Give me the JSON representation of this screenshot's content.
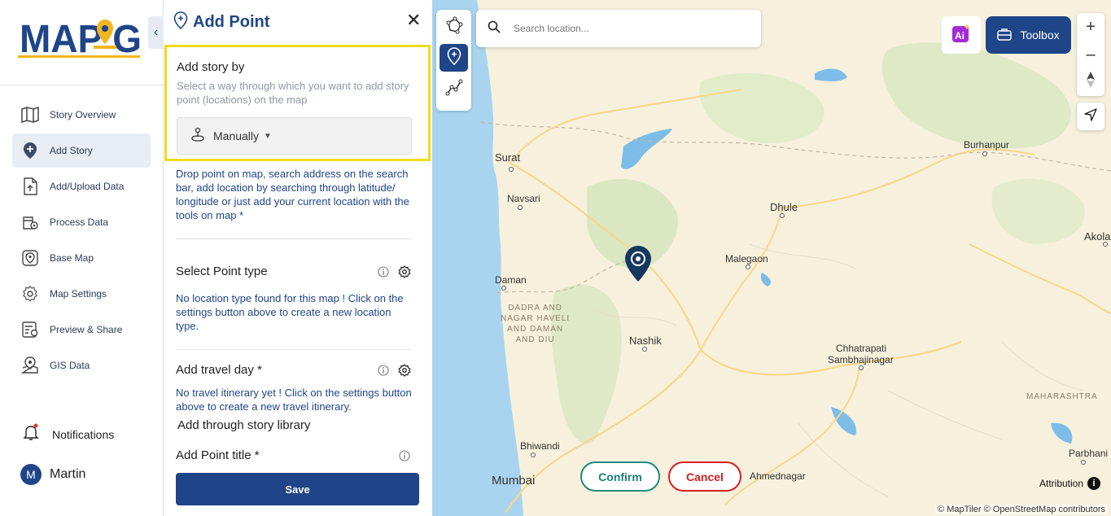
{
  "app": {
    "logo_text": "MAPOG"
  },
  "sidebar": {
    "items": [
      {
        "label": "Story Overview",
        "icon": "map-book-icon"
      },
      {
        "label": "Add Story",
        "icon": "map-pin-plus-icon",
        "active": true
      },
      {
        "label": "Add/Upload Data",
        "icon": "upload-file-icon"
      },
      {
        "label": "Process Data",
        "icon": "process-data-icon"
      },
      {
        "label": "Base Map",
        "icon": "base-map-icon"
      },
      {
        "label": "Map Settings",
        "icon": "gear-icon"
      },
      {
        "label": "Preview & Share",
        "icon": "preview-share-icon"
      },
      {
        "label": "GIS Data",
        "icon": "gis-data-icon"
      }
    ],
    "notifications_label": "Notifications",
    "user": {
      "initial": "M",
      "name": "Martin"
    }
  },
  "panel": {
    "title": "Add Point",
    "story_by": {
      "title": "Add story by",
      "description": "Select a way through which you want to add story point (locations) on the map",
      "selected": "Manually"
    },
    "help_text": "Drop point on map, search address on the search bar, add location by searching through latitude/ longitude or just add your current location with the tools on map *",
    "point_type": {
      "title": "Select Point type",
      "message": "No location type found for this map ! Click on the settings button above to create a new location type."
    },
    "travel_day": {
      "title": "Add travel day *",
      "message": "No travel itinerary yet ! Click on the settings button above to create a new travel itinerary."
    },
    "library_label": "Add through story library",
    "point_title_label": "Add Point title *",
    "save_label": "Save"
  },
  "map": {
    "search_placeholder": "Search location...",
    "toolbox_label": "Toolbox",
    "confirm_label": "Confirm",
    "cancel_label": "Cancel",
    "attribution_label": "Attribution",
    "copyright": "© MapTiler © OpenStreetMap contributors",
    "cities": {
      "surat": "Surat",
      "navsari": "Navsari",
      "dhule": "Dhule",
      "burhanpur": "Burhanpur",
      "akola": "Akola",
      "malegaon": "Malegaon",
      "daman": "Daman",
      "nashik": "Nashik",
      "chhatrapati": "Chhatrapati",
      "sambhajinagar": "Sambhajinagar",
      "bhiwandi": "Bhiwandi",
      "mumbai": "Mumbai",
      "ahmednagar": "Ahmednagar",
      "parbhani": "Parbhani",
      "region_dadra_1": "DADRA AND",
      "region_dadra_2": "NAGAR HAVELI",
      "region_dadra_3": "AND DAMAN",
      "region_dadra_4": "AND DIU",
      "region_maharashtra": "MAHARASHTRA"
    }
  },
  "colors": {
    "brand": "#1f4588",
    "highlight": "#f0dc1a",
    "confirm": "#1b8a7d",
    "cancel": "#d41f1f"
  }
}
